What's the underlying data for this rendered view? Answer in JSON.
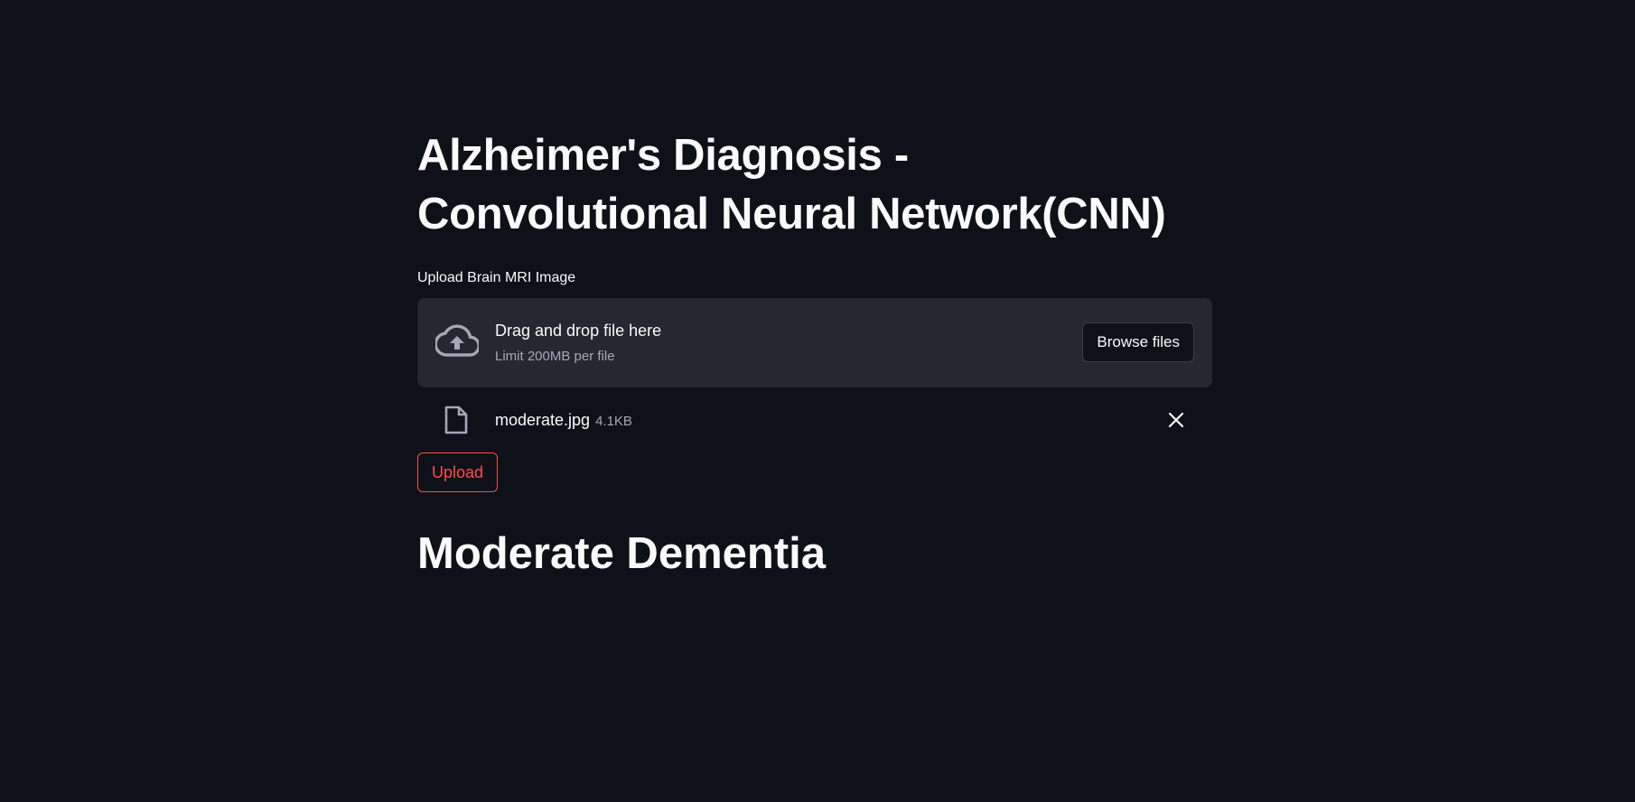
{
  "page": {
    "title_line1": "Alzheimer's Diagnosis -",
    "title_line2": "Convolutional Neural Network(CNN)"
  },
  "uploader": {
    "label": "Upload Brain MRI Image",
    "drag_text": "Drag and drop file here",
    "limit_text": "Limit 200MB per file",
    "browse_label": "Browse files",
    "icon": "cloud-upload-icon"
  },
  "file": {
    "name": "moderate.jpg",
    "size": "4.1KB",
    "icon": "file-icon",
    "remove_icon": "close-icon"
  },
  "actions": {
    "upload_label": "Upload"
  },
  "result": {
    "text": "Moderate Dementia"
  },
  "colors": {
    "background": "#0e1117",
    "surface": "#262730",
    "text": "#fafafa",
    "muted": "#a3a8b8",
    "accent": "#ff4b4b"
  }
}
